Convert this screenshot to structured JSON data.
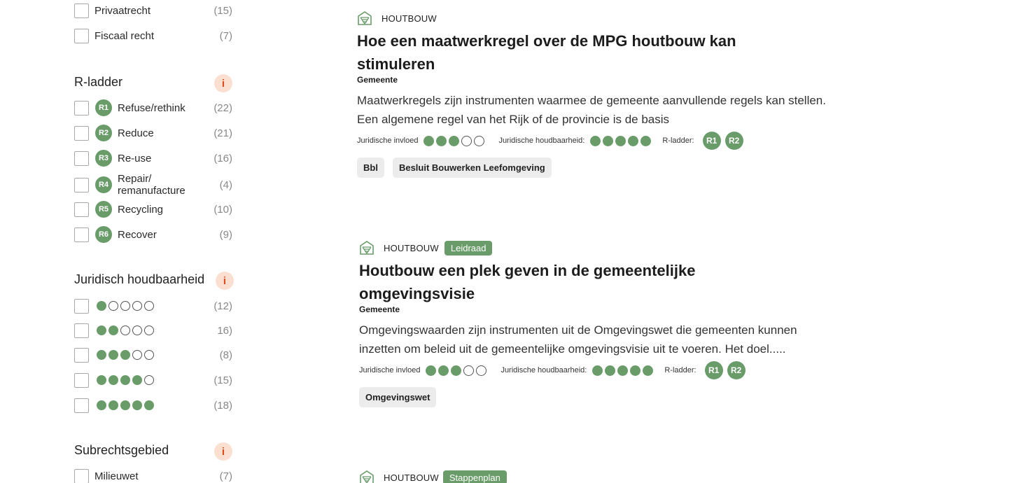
{
  "filters": {
    "rechtsgebied_items": [
      {
        "label": "Privaatrecht",
        "count": "(15)"
      },
      {
        "label": "Fiscaal recht",
        "count": "(7)"
      }
    ],
    "r_ladder": {
      "title": "R-ladder",
      "info": "i",
      "items": [
        {
          "badge": "R1",
          "label": "Refuse/rethink",
          "count": "(22)"
        },
        {
          "badge": "R2",
          "label": "Reduce",
          "count": "(21)"
        },
        {
          "badge": "R3",
          "label": "Re-use",
          "count": "(16)"
        },
        {
          "badge": "R4",
          "label_line1": "Repair/",
          "label_line2": "remanufacture",
          "count": "(4)"
        },
        {
          "badge": "R5",
          "label": "Recycling",
          "count": "(10)"
        },
        {
          "badge": "R6",
          "label": "Recover",
          "count": "(9)"
        }
      ]
    },
    "juridisch_houdbaarheid": {
      "title": "Juridisch houdbaarheid",
      "info": "i",
      "items": [
        {
          "level": 1,
          "count": "(12)"
        },
        {
          "level": 2,
          "count": "16)"
        },
        {
          "level": 3,
          "count": "(8)"
        },
        {
          "level": 4,
          "count": "(15)"
        },
        {
          "level": 5,
          "count": "(18)"
        }
      ]
    },
    "subrechtsgebied": {
      "title": "Subrechtsgebied",
      "info": "i",
      "items": [
        {
          "label": "Milieuwet",
          "count": "(7)"
        }
      ]
    }
  },
  "results": [
    {
      "category": "HOUTBOUW",
      "tag": "",
      "title": "Hoe een maatwerkregel over de MPG houtbouw kan stimuleren",
      "subtitle": "Gemeente",
      "description": "Maatwerkregels zijn instrumenten waarmee de gemeente aanvullende regels kan stellen. Een algemene regel van het Rijk of de provincie is de basis",
      "invloed_label": "Juridische invloed",
      "invloed_level": 3,
      "houdbaarheid_label": "Juridische houdbaarheid:",
      "houdbaarheid_level": 5,
      "r_ladder_label": "R-ladder:",
      "r_badges": [
        "R1",
        "R2"
      ],
      "chips": [
        "Bbl",
        "Besluit Bouwerken Leefomgeving"
      ]
    },
    {
      "category": "HOUTBOUW",
      "tag": "Leidraad",
      "title": "Houtbouw een plek geven in de gemeentelijke omgevingsvisie",
      "subtitle": "Gemeente",
      "description": "Omgevingswaarden zijn instrumenten uit de Omgevingswet die gemeenten kunnen inzetten om beleid uit de gemeentelijke omgevingsvisie uit te voeren. Het doel.....",
      "invloed_label": "Juridische invloed",
      "invloed_level": 3,
      "houdbaarheid_label": "Juridische houdbaarheid:",
      "houdbaarheid_level": 5,
      "r_ladder_label": "R-ladder:",
      "r_badges": [
        "R1",
        "R2"
      ],
      "chips": [
        "Omgevingswet"
      ]
    },
    {
      "category": "HOUTBOUW",
      "tag": "Stappenplan"
    }
  ],
  "colors": {
    "accent_green": "#6a9c6a",
    "info_bg": "#fbe0d2",
    "info_fg": "#e04a1a",
    "chip_bg": "#ececec"
  }
}
